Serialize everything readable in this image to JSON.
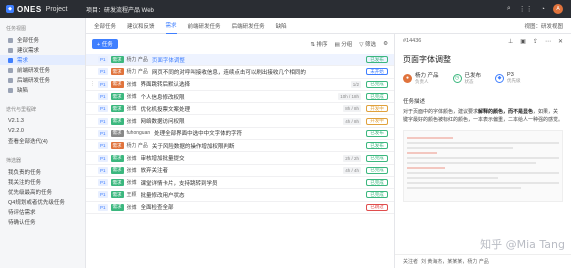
{
  "topbar": {
    "brand": "ONES",
    "brand_sub": "Project",
    "project_title": "项目：研发流程产品 Web",
    "avatar": "A"
  },
  "sidebar": {
    "section1": "任务视图",
    "items": [
      {
        "label": "全部任务",
        "active": false
      },
      {
        "label": "建议需求",
        "active": false
      },
      {
        "label": "需求",
        "active": true
      },
      {
        "label": "前端研发任务",
        "active": false
      },
      {
        "label": "后端研发任务",
        "active": false
      },
      {
        "label": "缺陷",
        "active": false
      }
    ],
    "section2": "迭代与里程碑",
    "versions": [
      "V2.1.3",
      "V2.2.0",
      "查看全部迭代(4)"
    ],
    "section3": "筛选器",
    "filters": [
      "我负责的任务",
      "我关注的任务",
      "优先级最高的任务",
      "Q4规划或者优先级任务",
      "待评估需求",
      "待确认任务"
    ]
  },
  "tabs": {
    "items": [
      "全部任务",
      "建议和反馈",
      "需求",
      "前端研发任务",
      "后端研发任务",
      "缺陷"
    ],
    "active_index": 2,
    "right": "视图：研发视图"
  },
  "toolbar": {
    "new_label": "+ 任务",
    "sort": "排序",
    "group": "分组",
    "filter": "筛选"
  },
  "rows": [
    {
      "pri": "P1",
      "type": "需求",
      "type_color": "#3bb77e",
      "assignee": "杨力 产品",
      "title": "页面字体调整",
      "hours": "",
      "status": "已发布",
      "status_color": "#3bb77e",
      "selected": true,
      "link": true
    },
    {
      "pri": "P1",
      "type": "需求",
      "type_color": "#e0733c",
      "assignee": "杨力 产品",
      "title": "网页不同的对呼叫接收信息，连续点击可以刷出接收几个相同的",
      "hours": "",
      "status": "未开始",
      "status_color": "#3f7fff",
      "selected": false,
      "link": false
    },
    {
      "pri": "P1",
      "type": "需求",
      "type_color": "#e0733c",
      "assignee": "张博",
      "title": "界面跳转后默认选择",
      "hours": "1/2",
      "status": "已完成",
      "status_color": "#3bb77e",
      "selected": false,
      "link": false,
      "handle": true
    },
    {
      "pri": "P1",
      "type": "需求",
      "type_color": "#3bb77e",
      "assignee": "张博",
      "title": "个人信息修改权限",
      "hours": "10h / 18h",
      "status": "已完成",
      "status_color": "#3bb77e",
      "selected": false,
      "link": false
    },
    {
      "pri": "P1",
      "type": "需求",
      "type_color": "#3bb77e",
      "assignee": "张博",
      "title": "优化机投票文案处理",
      "hours": "8h / 8h",
      "status": "开发中",
      "status_color": "#e0a13c",
      "selected": false,
      "link": false
    },
    {
      "pri": "P1",
      "type": "需求",
      "type_color": "#3bb77e",
      "assignee": "张博",
      "title": "网络数据访问权限",
      "hours": "4h / 8h",
      "status": "开发中",
      "status_color": "#e0a13c",
      "selected": false,
      "link": false
    },
    {
      "pri": "P1",
      "type": "需求",
      "type_color": "#888",
      "assignee": "fuhonguan",
      "title": "处理全部界面中选中中文字体的字符",
      "hours": "",
      "status": "已发布",
      "status_color": "#3bb77e",
      "selected": false,
      "link": false
    },
    {
      "pri": "P1",
      "type": "需求",
      "type_color": "#e0733c",
      "assignee": "杨力 产品",
      "title": "关于风险数据的操作增加权限判断",
      "hours": "",
      "status": "已发布",
      "status_color": "#3bb77e",
      "selected": false,
      "link": false
    },
    {
      "pri": "P1",
      "type": "需求",
      "type_color": "#3bb77e",
      "assignee": "张博",
      "title": "审核增加批量提交",
      "hours": "2h / 2h",
      "status": "已完成",
      "status_color": "#3bb77e",
      "selected": false,
      "link": false
    },
    {
      "pri": "P1",
      "type": "需求",
      "type_color": "#3bb77e",
      "assignee": "张博",
      "title": "放弃关注者",
      "hours": "4h / 4h",
      "status": "已完成",
      "status_color": "#3bb77e",
      "selected": false,
      "link": false
    },
    {
      "pri": "P1",
      "type": "需求",
      "type_color": "#3bb77e",
      "assignee": "张博",
      "title": "课堂详情卡片，支持跳转到学员",
      "hours": "",
      "status": "已完成",
      "status_color": "#3bb77e",
      "selected": false,
      "link": false
    },
    {
      "pri": "P1",
      "type": "需求",
      "type_color": "#3bb77e",
      "assignee": "王颖",
      "title": "批量修改用户状态",
      "hours": "",
      "status": "已完成",
      "status_color": "#3bb77e",
      "selected": false,
      "link": false
    },
    {
      "pri": "P1",
      "type": "需求",
      "type_color": "#3bb77e",
      "assignee": "张博",
      "title": "全面检查全部",
      "hours": "",
      "status": "已跳过",
      "status_color": "#e04d4d",
      "selected": false,
      "link": false
    }
  ],
  "detail": {
    "id": "#14436",
    "title": "页面字体调整",
    "assignee": "杨力 产品",
    "assignee_label": "负责人",
    "status": "已发布",
    "status_label": "状态",
    "priority": "P3",
    "priority_label": "优先级",
    "tab_desc": "任务描述",
    "tab_comment": "评论",
    "section": "任务描述",
    "desc_pre": "对于页面中的字体颜色，建议要求",
    "desc_bold": "解释的颜色，而不是显色",
    "desc_post": "，如果，关键字最好的颜色被标红的颜色，一本表示偏重，二本给人一种强的感觉。",
    "footer_label": "关注者",
    "footer_value": "刘 黄海杰，某某某，杨力 产品"
  },
  "watermark": "知乎 @Mia Tang"
}
